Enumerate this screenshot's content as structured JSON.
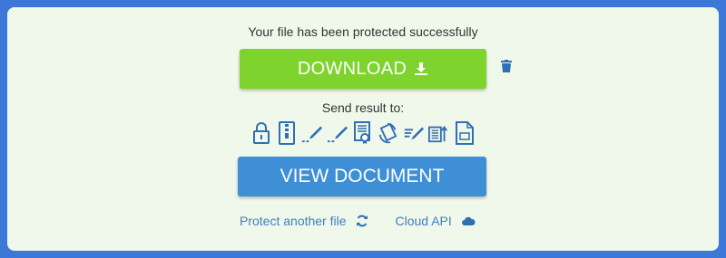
{
  "status_message": "Your file has been protected successfully",
  "download_button": {
    "label": "DOWNLOAD",
    "icon": "download-icon"
  },
  "delete_icon": "trash-icon",
  "send_result": {
    "label": "Send result to:",
    "icons": [
      "lock-icon",
      "zip-file-icon",
      "sign-icon",
      "sign-icon",
      "certificate-icon",
      "rotate-document-icon",
      "edit-icon",
      "reorder-pages-icon",
      "document-icon"
    ]
  },
  "view_button": {
    "label": "VIEW DOCUMENT"
  },
  "links": {
    "protect_another": "Protect another file",
    "cloud_api": "Cloud API"
  },
  "colors": {
    "background": "#3b78d8",
    "panel": "#f0f8ec",
    "download": "#7ed32c",
    "view": "#3e8fd6",
    "link": "#3d7fbf"
  }
}
